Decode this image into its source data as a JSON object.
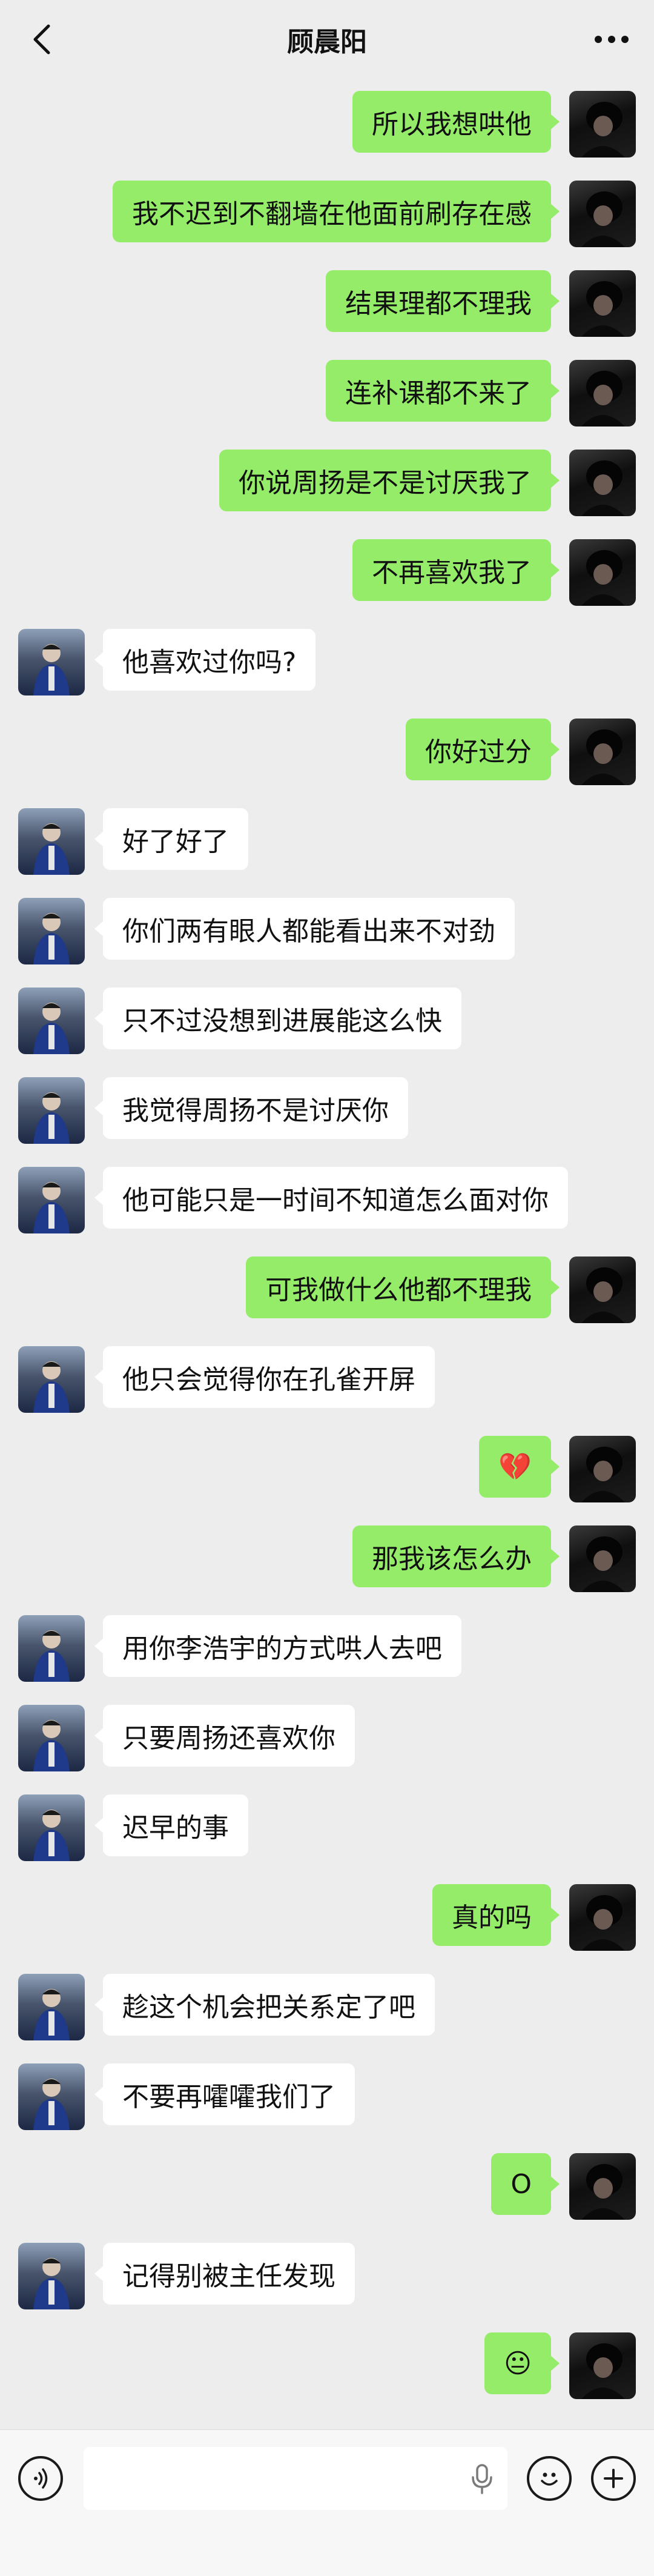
{
  "header": {
    "title": "顾晨阳"
  },
  "messages": [
    {
      "side": "me",
      "text": "所以我想哄他"
    },
    {
      "side": "me",
      "text": "我不迟到不翻墙在他面前刷存在感"
    },
    {
      "side": "me",
      "text": "结果理都不理我"
    },
    {
      "side": "me",
      "text": "连补课都不来了"
    },
    {
      "side": "me",
      "text": "你说周扬是不是讨厌我了"
    },
    {
      "side": "me",
      "text": "不再喜欢我了"
    },
    {
      "side": "other",
      "text": "他喜欢过你吗?"
    },
    {
      "side": "me",
      "text": "你好过分"
    },
    {
      "side": "other",
      "text": "好了好了"
    },
    {
      "side": "other",
      "text": "你们两有眼人都能看出来不对劲"
    },
    {
      "side": "other",
      "text": "只不过没想到进展能这么快"
    },
    {
      "side": "other",
      "text": "我觉得周扬不是讨厌你"
    },
    {
      "side": "other",
      "text": "他可能只是一时间不知道怎么面对你"
    },
    {
      "side": "me",
      "text": "可我做什么他都不理我"
    },
    {
      "side": "other",
      "text": "他只会觉得你在孔雀开屏"
    },
    {
      "side": "me",
      "text": "💔"
    },
    {
      "side": "me",
      "text": "那我该怎么办"
    },
    {
      "side": "other",
      "text": "用你李浩宇的方式哄人去吧"
    },
    {
      "side": "other",
      "text": "只要周扬还喜欢你"
    },
    {
      "side": "other",
      "text": "迟早的事"
    },
    {
      "side": "me",
      "text": "真的吗"
    },
    {
      "side": "other",
      "text": "趁这个机会把关系定了吧"
    },
    {
      "side": "other",
      "text": "不要再嚯嚯我们了"
    },
    {
      "side": "me",
      "text": "O"
    },
    {
      "side": "other",
      "text": "记得别被主任发现"
    },
    {
      "side": "me",
      "text": "😐"
    }
  ],
  "colors": {
    "my_bubble": "#95ec69",
    "other_bubble": "#ffffff",
    "background": "#ededed"
  },
  "icons": {
    "back": "chevron-left-icon",
    "more": "more-dots-icon",
    "voice": "voice-icon",
    "mic": "microphone-icon",
    "emoji": "emoji-icon",
    "plus": "plus-icon"
  }
}
